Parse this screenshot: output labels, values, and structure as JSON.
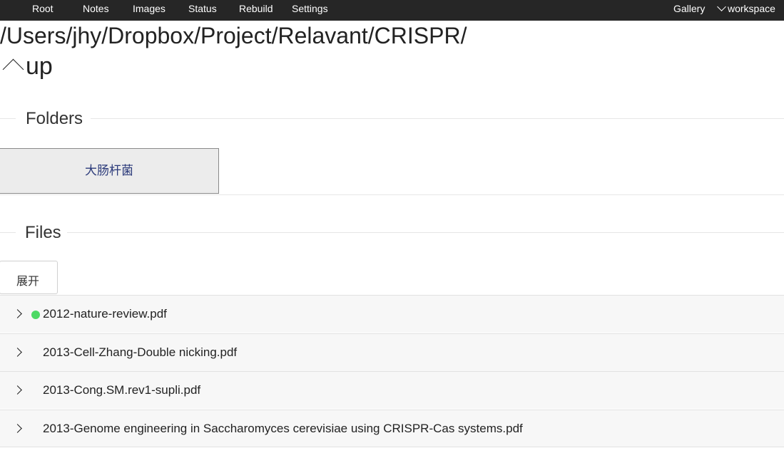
{
  "nav": {
    "items": [
      "Root",
      "Notes",
      "Images",
      "Status",
      "Rebuild",
      "Settings"
    ],
    "gallery": "Gallery",
    "workspace": "workspace"
  },
  "path": "/Users/jhy/Dropbox/Project/Relavant/CRISPR/",
  "up_label": "up",
  "folders": {
    "title": "Folders",
    "items": [
      "大肠杆菌"
    ]
  },
  "files": {
    "title": "Files",
    "expand_label": "展开",
    "items": [
      {
        "name": "2012-nature-review.pdf",
        "status": "active"
      },
      {
        "name": "2013-Cell-Zhang-Double nicking.pdf",
        "status": ""
      },
      {
        "name": "2013-Cong.SM.rev1-supli.pdf",
        "status": ""
      },
      {
        "name": "2013-Genome engineering in Saccharomyces cerevisiae using CRISPR-Cas systems.pdf",
        "status": ""
      }
    ]
  },
  "colors": {
    "status_active": "#4cd964",
    "nav_bg": "#262626"
  }
}
